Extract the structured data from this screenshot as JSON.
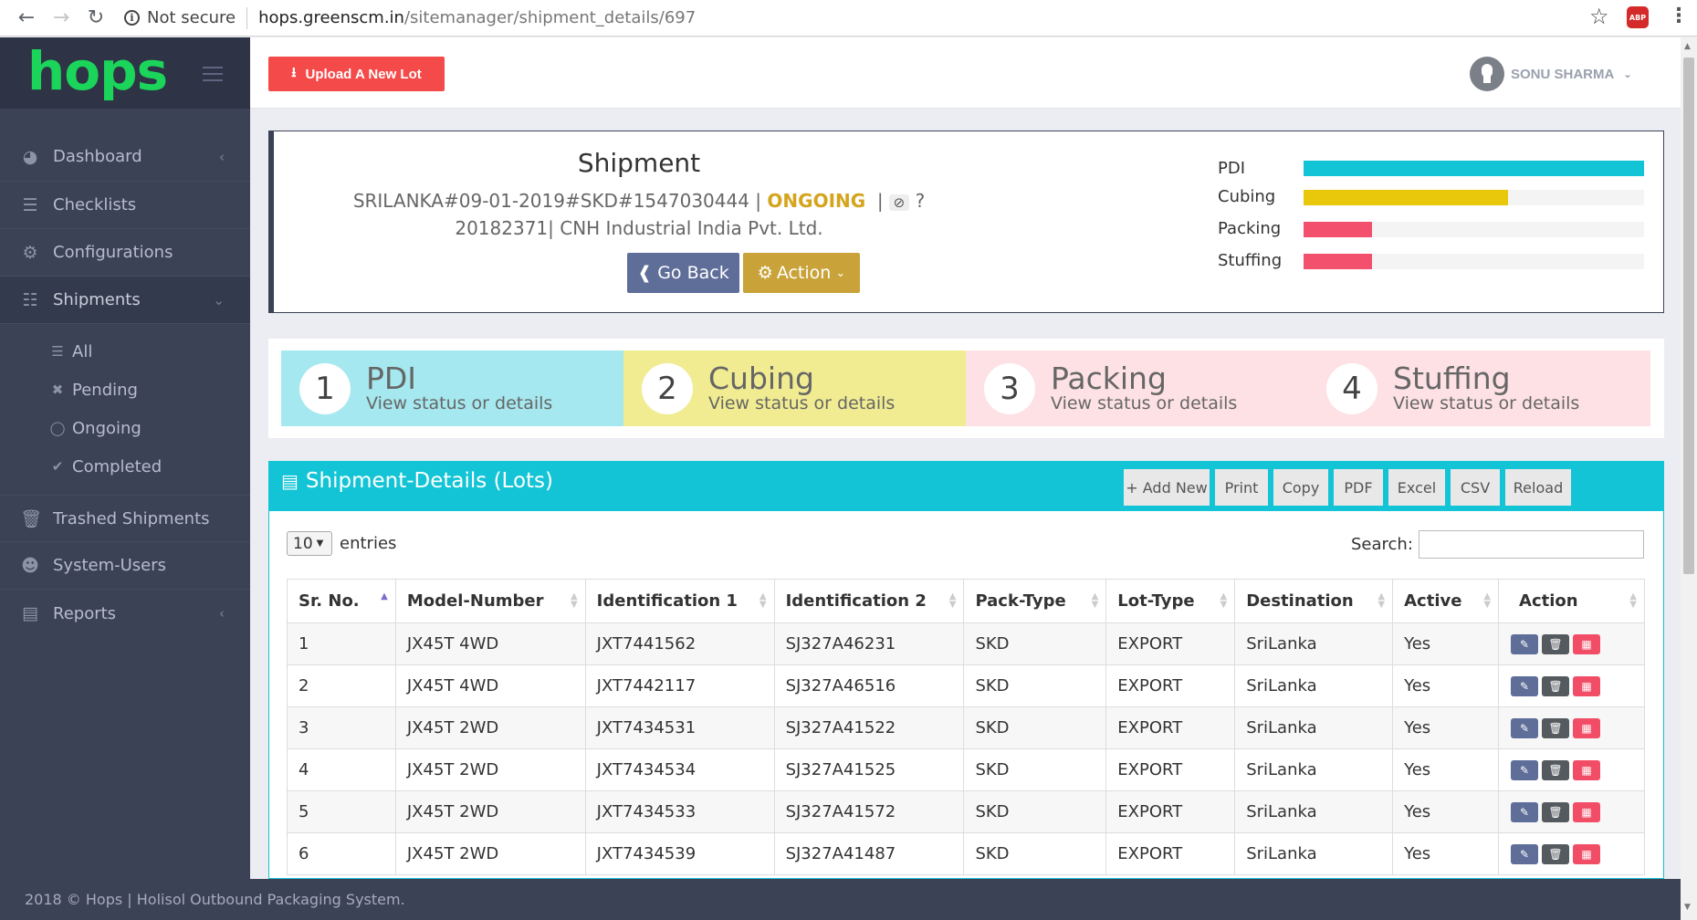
{
  "browser": {
    "security_label": "Not secure",
    "url_host": "hops.greenscm.in",
    "url_path": "/sitemanager/shipment_details/697",
    "extension_label": "ABP"
  },
  "sidebar": {
    "logo": "hops",
    "items": [
      {
        "label": "Dashboard",
        "icon": "dashboard-icon"
      },
      {
        "label": "Checklists",
        "icon": "layers-icon"
      },
      {
        "label": "Configurations",
        "icon": "gears-icon"
      },
      {
        "label": "Shipments",
        "icon": "database-icon"
      },
      {
        "label": "Trashed Shipments",
        "icon": "trash-icon"
      },
      {
        "label": "System-Users",
        "icon": "user-icon"
      },
      {
        "label": "Reports",
        "icon": "file-icon"
      }
    ],
    "sub_items": [
      {
        "label": "All",
        "icon": "list-icon"
      },
      {
        "label": "Pending",
        "icon": "x-icon"
      },
      {
        "label": "Ongoing",
        "icon": "circle-icon"
      },
      {
        "label": "Completed",
        "icon": "check-icon"
      }
    ]
  },
  "topbar": {
    "upload_label": "Upload A New Lot",
    "user_name": "SONU SHARMA"
  },
  "shipment": {
    "title": "Shipment",
    "code": "SRILANKA#09-01-2019#SKD#1547030444",
    "status": "ONGOING",
    "status_color": "#d4a41c",
    "help": "?",
    "line2": "20182371| CNH Industrial India Pvt. Ltd.",
    "go_back_label": "Go Back",
    "action_label": "Action",
    "progress": [
      {
        "label": "PDI",
        "fraction": 1.0,
        "color": "#13c4d6"
      },
      {
        "label": "Cubing",
        "fraction": 0.6,
        "color": "#e9c70a"
      },
      {
        "label": "Packing",
        "fraction": 0.2,
        "color": "#f2506d"
      },
      {
        "label": "Stuffing",
        "fraction": 0.2,
        "color": "#f2506d"
      }
    ]
  },
  "steps": [
    {
      "num": "1",
      "title": "PDI",
      "sub": "View status or details",
      "color": "#a5e8ef"
    },
    {
      "num": "2",
      "title": "Cubing",
      "sub": "View status or details",
      "color": "#f1ec91"
    },
    {
      "num": "3",
      "title": "Packing",
      "sub": "View status or details",
      "color": "#fde1e5"
    },
    {
      "num": "4",
      "title": "Stuffing",
      "sub": "View status or details",
      "color": "#fde1e5"
    }
  ],
  "lots": {
    "title": "Shipment-Details (Lots)",
    "toolbar": [
      "+ Add New",
      "Print",
      "Copy",
      "PDF",
      "Excel",
      "CSV",
      "Reload"
    ],
    "entries_value": "10",
    "entries_label": "entries",
    "search_label": "Search:",
    "columns": [
      "Sr. No.",
      "Model-Number",
      "Identification 1",
      "Identification 2",
      "Pack-Type",
      "Lot-Type",
      "Destination",
      "Active",
      "Action"
    ],
    "rows": [
      [
        "1",
        "JX45T 4WD",
        "JXT7441562",
        "SJ327A46231",
        "SKD",
        "EXPORT",
        "SriLanka",
        "Yes"
      ],
      [
        "2",
        "JX45T 4WD",
        "JXT7442117",
        "SJ327A46516",
        "SKD",
        "EXPORT",
        "SriLanka",
        "Yes"
      ],
      [
        "3",
        "JX45T 2WD",
        "JXT7434531",
        "SJ327A41522",
        "SKD",
        "EXPORT",
        "SriLanka",
        "Yes"
      ],
      [
        "4",
        "JX45T 2WD",
        "JXT7434534",
        "SJ327A41525",
        "SKD",
        "EXPORT",
        "SriLanka",
        "Yes"
      ],
      [
        "5",
        "JX45T 2WD",
        "JXT7434533",
        "SJ327A41572",
        "SKD",
        "EXPORT",
        "SriLanka",
        "Yes"
      ],
      [
        "6",
        "JX45T 2WD",
        "JXT7434539",
        "SJ327A41487",
        "SKD",
        "EXPORT",
        "SriLanka",
        "Yes"
      ]
    ]
  },
  "footer": "2018 © Hops | Holisol Outbound Packaging System."
}
